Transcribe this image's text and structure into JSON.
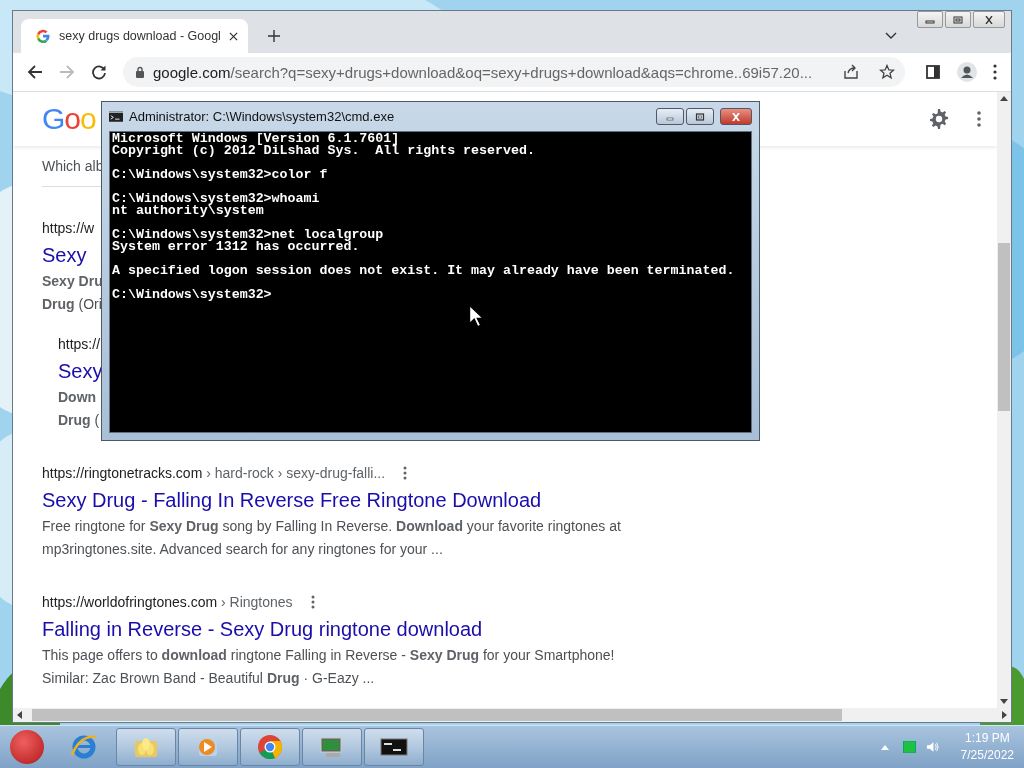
{
  "browser": {
    "tab_title": "sexy drugs download - Googl",
    "url_host": "google.com",
    "url_path": "/search?q=sexy+drugs+download&oq=sexy+drugs+download&aqs=chrome..69i57.20...",
    "forward_disabled": true
  },
  "page": {
    "logo": "Goo",
    "filter_text": "Which alb",
    "results": [
      {
        "site": "https://w",
        "title": "Sexy",
        "snippet": [
          "**Sexy Dru**",
          "**Drug** (Ori"
        ],
        "children": [
          {
            "site": "https://",
            "title": "Sexy",
            "snippet": [
              "**Down**",
              "**Drug** ("
            ]
          }
        ]
      },
      {
        "site": "https://ringtonetracks.com",
        "path": " › hard-rock › sexy-drug-falli...",
        "menu": true,
        "title": "Sexy Drug - Falling In Reverse Free Ringtone Download",
        "snippet": [
          "Free ringtone for **Sexy Drug** song by Falling In Reverse. **Download** your favorite ringtones at",
          "mp3ringtones.site. Advanced search for any ringtones for your ..."
        ]
      },
      {
        "site": "https://worldofringtones.com",
        "path": " › Ringtones",
        "menu": true,
        "title": "Falling in Reverse - Sexy Drug ringtone download",
        "snippet": [
          "This page offers to **download** ringtone Falling in Reverse - **Sexy Drug** for your Smartphone!",
          "Similar: Zac Brown Band - Beautiful **Drug** · G-Eazy ..."
        ]
      }
    ]
  },
  "console": {
    "title": "Administrator: C:\\Windows\\system32\\cmd.exe",
    "blocks": [
      [
        "Microsoft Windows [Version 6.1.7601]",
        "Copyright (c) 2012 DiLshad Sys.  All rights reserved."
      ],
      [
        "C:\\Windows\\system32>color f"
      ],
      [
        "C:\\Windows\\system32>whoami",
        "nt authority\\system"
      ],
      [
        "C:\\Windows\\system32>net localgroup",
        "System error 1312 has occurred."
      ],
      [
        "A specified logon session does not exist. It may already have been terminated."
      ],
      [
        "C:\\Windows\\system32>"
      ]
    ]
  },
  "taskbar": {
    "items": [
      {
        "kind": "ie",
        "running": false
      },
      {
        "kind": "folder",
        "running": true
      },
      {
        "kind": "media",
        "running": true
      },
      {
        "kind": "chrome",
        "running": true
      },
      {
        "kind": "network",
        "running": true
      },
      {
        "kind": "console",
        "running": true
      }
    ],
    "time": "1:19 PM",
    "date": "7/25/2022"
  }
}
